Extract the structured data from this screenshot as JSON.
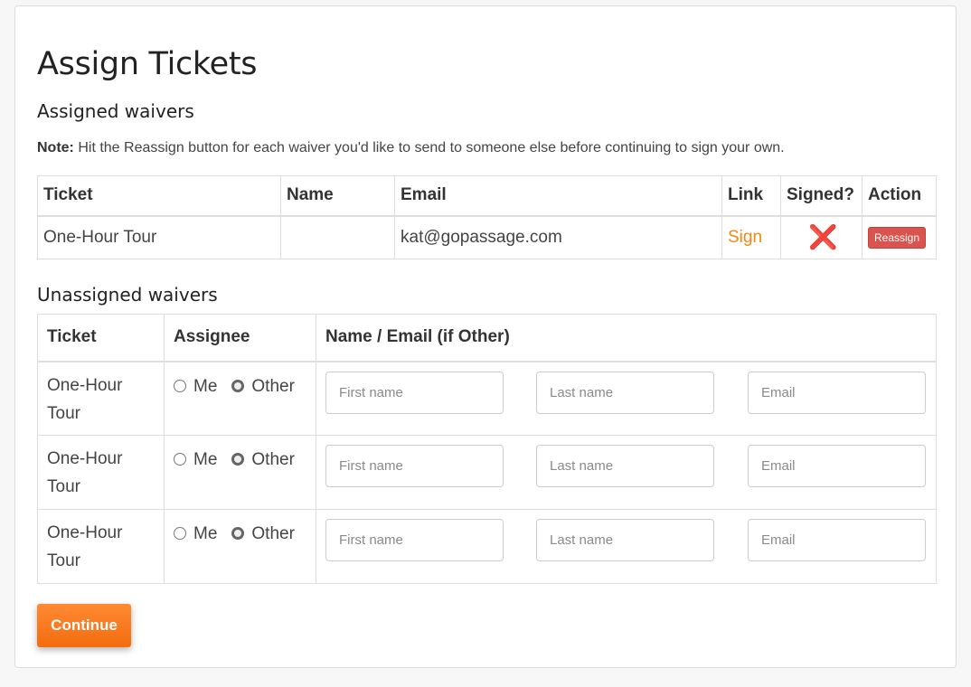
{
  "title": "Assign Tickets",
  "assigned": {
    "heading": "Assigned waivers",
    "note_label": "Note:",
    "note_text": " Hit the Reassign button for each waiver you'd like to send to someone else before continuing to sign your own.",
    "columns": [
      "Ticket",
      "Name",
      "Email",
      "Link",
      "Signed?",
      "Action"
    ],
    "rows": [
      {
        "ticket": "One-Hour Tour",
        "name": "",
        "email": "kat@gopassage.com",
        "link": "Sign",
        "signed": "❌",
        "action": "Reassign"
      }
    ]
  },
  "unassigned": {
    "heading": "Unassigned waivers",
    "columns": [
      "Ticket",
      "Assignee",
      "Name / Email (if Other)"
    ],
    "option_me": "Me",
    "option_other": "Other",
    "placeholders": {
      "first": "First name",
      "last": "Last name",
      "email": "Email"
    },
    "rows": [
      {
        "ticket_line1": "One-Hour",
        "ticket_line2": "Tour"
      },
      {
        "ticket_line1": "One-Hour",
        "ticket_line2": "Tour"
      },
      {
        "ticket_line1": "One-Hour",
        "ticket_line2": "Tour"
      }
    ]
  },
  "continue_label": "Continue",
  "colors": {
    "accent": "#f7870f",
    "danger": "#d9534f"
  }
}
